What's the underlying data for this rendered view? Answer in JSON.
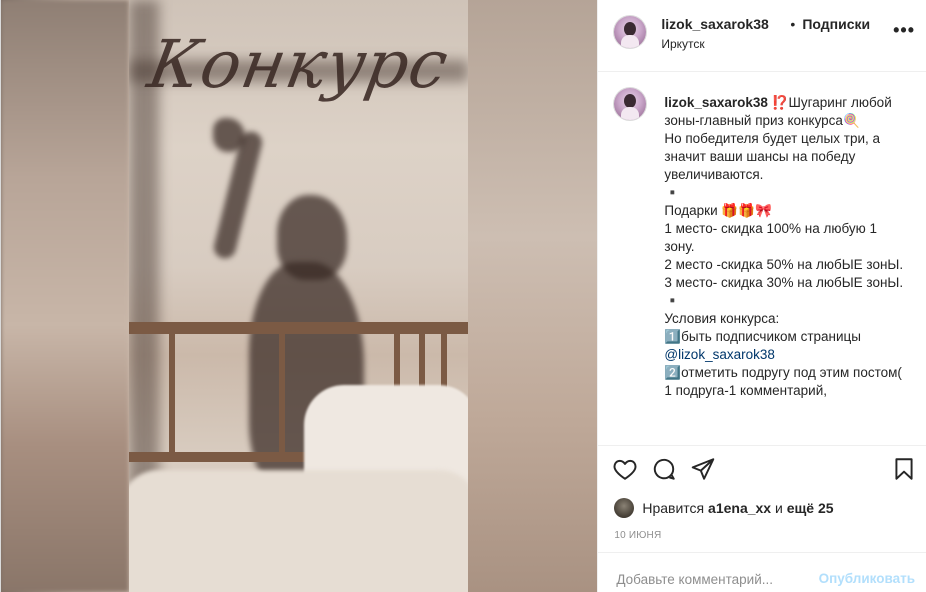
{
  "post": {
    "media": {
      "overlay_text": "Конкурс"
    },
    "header": {
      "username": "lizok_saxarok38",
      "separator": "•",
      "follow_label": "Подписки",
      "location": "Иркутск",
      "more_label": "•••"
    },
    "caption": {
      "username": "lizok_saxarok38",
      "lines": [
        "⁉️Шугаринг любой зоны-главный приз конкурса🍭",
        "Но победителя будет целых три, а значит ваши шансы на победу увеличиваются.",
        "▪️",
        "Подарки 🎁🎁🎀",
        "1 место- скидка 100% на любую 1 зону.",
        "2 место -скидка 50% на любЫЕ зонЫ.",
        "3 место- скидка 30% на любЫЕ зонЫ.",
        "▪️",
        "Условия конкурса:"
      ],
      "condition_1_prefix": "1️⃣быть подписчиком страницы",
      "mention": "@lizok_saxarok38",
      "condition_2": "2️⃣отметить подругу под этим постом( 1 подруга-1 комментарий,"
    },
    "actions": {
      "like_icon": "heart-icon",
      "comment_icon": "comment-icon",
      "share_icon": "paper-plane-icon",
      "save_icon": "bookmark-icon"
    },
    "likes": {
      "prefix": "Нравится",
      "user": "a1ena_xx",
      "connector": "и",
      "others": "ещё 25"
    },
    "date": "10 ИЮНЯ",
    "comment_box": {
      "placeholder": "Добавьте комментарий...",
      "publish_label": "Опубликовать"
    }
  },
  "colors": {
    "text": "#262626",
    "muted": "#8e8e8e",
    "link": "#00376b",
    "publish_disabled": "#b2dffc",
    "border": "#efefef"
  }
}
